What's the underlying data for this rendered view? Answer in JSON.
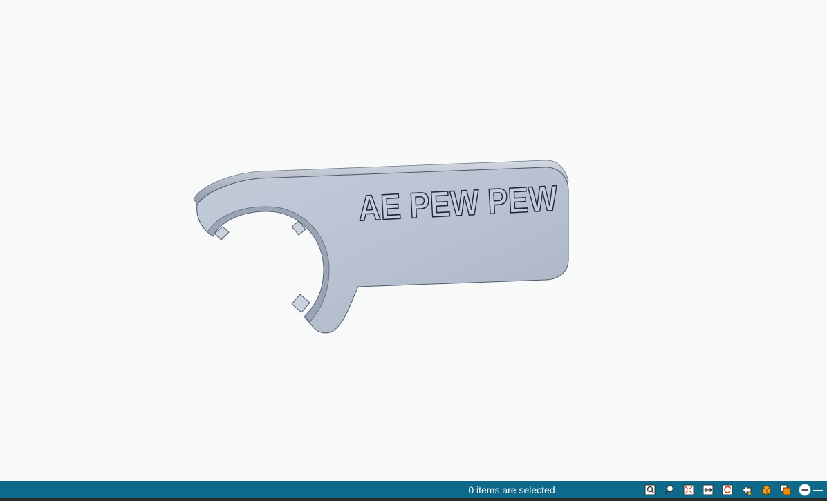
{
  "viewport": {
    "model_text": "AE PEW PEW",
    "background": "#f8fafa",
    "model_color": "#b9c3d2",
    "model_edge_color": "#1f2740"
  },
  "status_bar": {
    "selection_text": "0 items are selected",
    "background": "#0e6a8a"
  },
  "toolbar": {
    "icons": [
      "zoom-to-fit-icon",
      "zoom-icon",
      "fit-all-icon",
      "pan-icon",
      "rotate-icon",
      "select-filter-icon",
      "view-cube-icon",
      "display-mode-icon",
      "minus-circle-icon"
    ]
  }
}
